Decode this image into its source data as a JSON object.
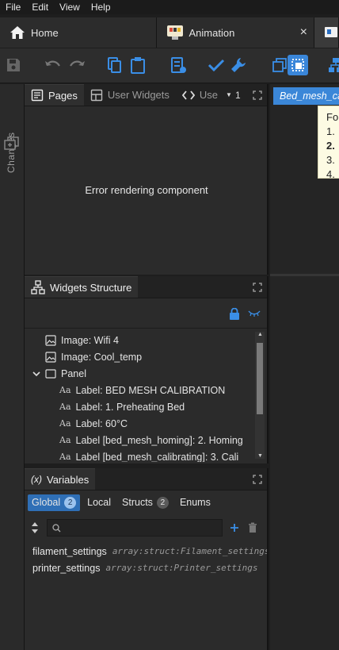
{
  "menu": [
    "File",
    "Edit",
    "View",
    "Help"
  ],
  "tabs": [
    {
      "label": "Home",
      "icon": "home-icon"
    },
    {
      "label": "Animation",
      "icon": "animation-project-icon",
      "close": "×"
    }
  ],
  "pages_panel": {
    "tabs": [
      {
        "label": "Pages",
        "icon": "pages-icon"
      },
      {
        "label": "User Widgets",
        "icon": "user-widgets-icon"
      },
      {
        "label": "Use",
        "icon": "code-icon"
      }
    ],
    "overflow_count": "1",
    "error": "Error rendering component"
  },
  "changes_label": "Changes",
  "widgets_structure": {
    "title": "Widgets Structure",
    "items": [
      {
        "label": "Image: Wifi 4",
        "icon": "image-icon",
        "indent": 1
      },
      {
        "label": "Image: Cool_temp",
        "icon": "image-icon",
        "indent": 1
      },
      {
        "label": "Panel",
        "icon": "panel-icon",
        "indent": 0,
        "expanded": true
      },
      {
        "label": "Label: BED MESH CALIBRATION",
        "icon": "label-icon",
        "indent": 2
      },
      {
        "label": "Label: 1. Preheating Bed",
        "icon": "label-icon",
        "indent": 2
      },
      {
        "label": "Label: 60°C",
        "icon": "label-icon",
        "indent": 2
      },
      {
        "label": "Label [bed_mesh_homing]: 2. Homing",
        "icon": "label-icon",
        "indent": 2
      },
      {
        "label": "Label [bed_mesh_calibrating]: 3. Cali",
        "icon": "label-icon",
        "indent": 2
      }
    ]
  },
  "variables": {
    "title": "Variables",
    "filters": [
      {
        "label": "Global",
        "count": "2",
        "active": true
      },
      {
        "label": "Local",
        "count": null,
        "active": false
      },
      {
        "label": "Structs",
        "count": "2",
        "active": false
      },
      {
        "label": "Enums",
        "count": null,
        "active": false
      }
    ],
    "search_placeholder": "",
    "items": [
      {
        "name": "filament_settings",
        "type": "array:struct:Filament_settings"
      },
      {
        "name": "printer_settings",
        "type": "array:struct:Printer_settings"
      }
    ]
  },
  "canvas": {
    "screen_tab": "Bed_mesh_calibration",
    "tooltip_lines": [
      "For",
      "1.",
      "2.",
      "3.",
      "4."
    ]
  },
  "colors": {
    "accent": "#3b87d8",
    "lock": "#3a8ee6",
    "check": "#3a8ee6"
  }
}
